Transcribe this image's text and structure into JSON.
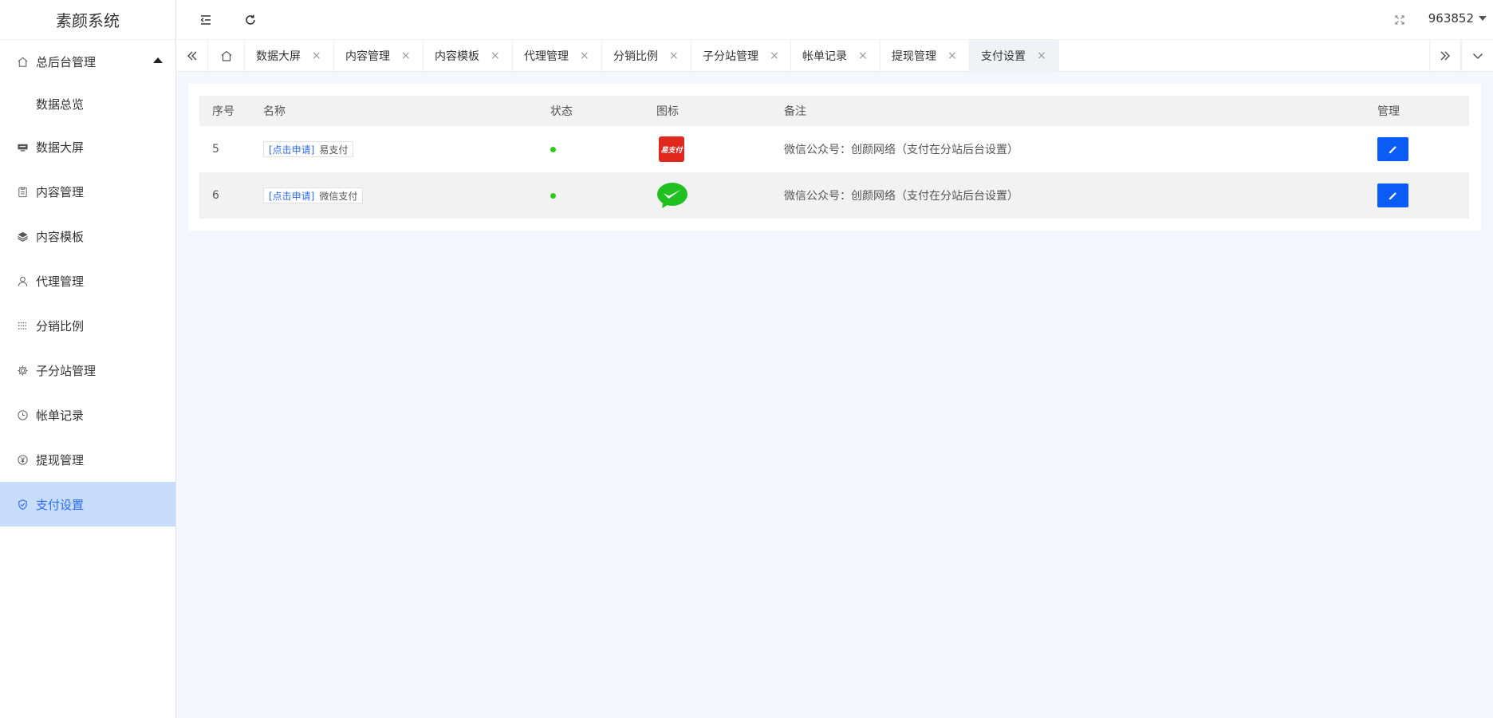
{
  "app": {
    "title": "素颜系统"
  },
  "sidebar": {
    "items": [
      {
        "label": "总后台管理",
        "icon": "home-icon"
      },
      {
        "label": "数据总览",
        "icon": ""
      },
      {
        "label": "数据大屏",
        "icon": "monitor-icon"
      },
      {
        "label": "内容管理",
        "icon": "clipboard-icon"
      },
      {
        "label": "内容模板",
        "icon": "layers-icon"
      },
      {
        "label": "代理管理",
        "icon": "user-icon"
      },
      {
        "label": "分销比例",
        "icon": "grid-dots-icon"
      },
      {
        "label": "子分站管理",
        "icon": "gear-icon"
      },
      {
        "label": "帐单记录",
        "icon": "clock-icon"
      },
      {
        "label": "提现管理",
        "icon": "yen-icon"
      },
      {
        "label": "支付设置",
        "icon": "shield-check-icon"
      }
    ],
    "active_index": 10
  },
  "header": {
    "user": "963852"
  },
  "tabs": [
    {
      "label": "数据大屏"
    },
    {
      "label": "内容管理"
    },
    {
      "label": "内容模板"
    },
    {
      "label": "代理管理"
    },
    {
      "label": "分销比例"
    },
    {
      "label": "子分站管理"
    },
    {
      "label": "帐单记录"
    },
    {
      "label": "提现管理"
    },
    {
      "label": "支付设置"
    }
  ],
  "tab_close_glyph": "×",
  "table": {
    "columns": [
      "序号",
      "名称",
      "状态",
      "图标",
      "备注",
      "管理"
    ],
    "rows": [
      {
        "id": "5",
        "apply_link": "[点击申请]",
        "name": "易支付",
        "status_color": "#2ecc1a",
        "icon_text": "易支付",
        "icon": "epay-logo",
        "note": "微信公众号：创颜网络（支付在分站后台设置）"
      },
      {
        "id": "6",
        "apply_link": "[点击申请]",
        "name": "微信支付",
        "status_color": "#2ecc1a",
        "icon": "wechat-pay-logo",
        "note": "微信公众号：创颜网络（支付在分站后台设置）"
      }
    ]
  },
  "colors": {
    "accent": "#2d6df6",
    "active_menu_bg": "#c8ddfc",
    "edit_button": "#0a5cf5",
    "status_on": "#2ecc1a"
  }
}
